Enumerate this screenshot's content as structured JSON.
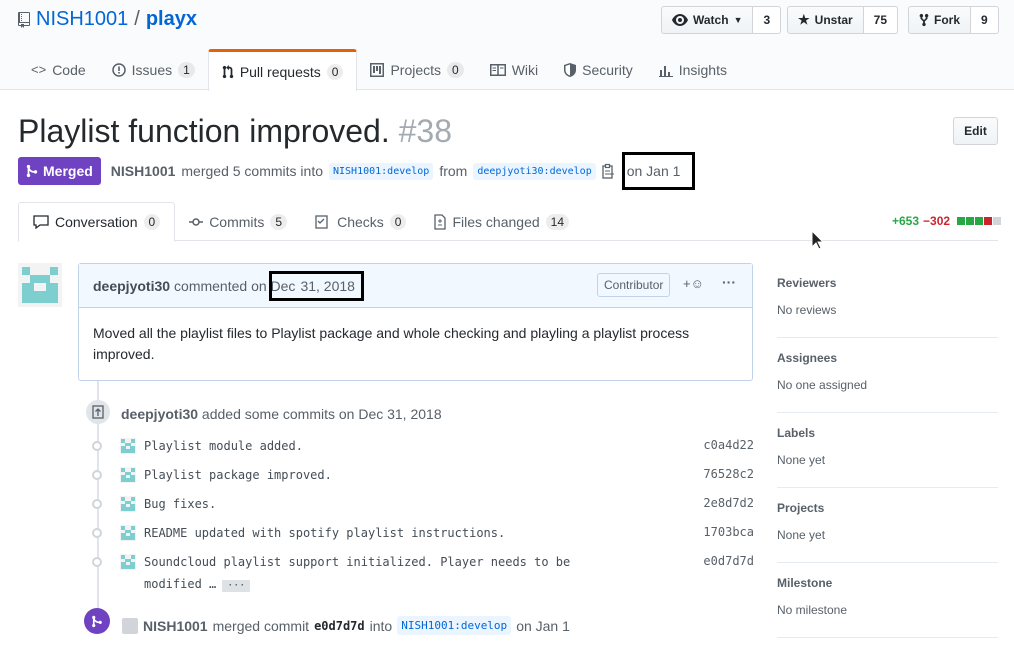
{
  "repo": {
    "owner": "NISH1001",
    "separator": "/",
    "name": "playx"
  },
  "actions": {
    "watch_label": "Watch",
    "watch_count": "3",
    "unstar_label": "Unstar",
    "star_count": "75",
    "fork_label": "Fork",
    "fork_count": "9"
  },
  "reponav": [
    {
      "label": "Code",
      "count": null
    },
    {
      "label": "Issues",
      "count": "1"
    },
    {
      "label": "Pull requests",
      "count": "0"
    },
    {
      "label": "Projects",
      "count": "0"
    },
    {
      "label": "Wiki",
      "count": null
    },
    {
      "label": "Security",
      "count": null
    },
    {
      "label": "Insights",
      "count": null
    }
  ],
  "pr": {
    "title": "Playlist function improved.",
    "number": "#38",
    "edit_label": "Edit",
    "state": "Merged",
    "merger": "NISH1001",
    "merged_text": "merged 5 commits into",
    "base_branch": "NISH1001:develop",
    "from_text": "from",
    "head_branch": "deepjyoti30:develop",
    "merged_date": "on Jan 1"
  },
  "tabs": [
    {
      "label": "Conversation",
      "count": "0"
    },
    {
      "label": "Commits",
      "count": "5"
    },
    {
      "label": "Checks",
      "count": "0"
    },
    {
      "label": "Files changed",
      "count": "14"
    }
  ],
  "diffstat": {
    "additions": "+653",
    "deletions": "−302",
    "colors": [
      "#28a745",
      "#28a745",
      "#28a745",
      "#cb2431",
      "#d1d5da"
    ]
  },
  "comment": {
    "author": "deepjyoti30",
    "commented_on": "commented on Dec",
    "date": "31, 2018",
    "badge": "Contributor",
    "body": "Moved all the playlist files to Playlist package and whole checking and playling a playlist process improved."
  },
  "commits_event": {
    "author": "deepjyoti30",
    "text": "added some commits on Dec 31, 2018"
  },
  "commits": [
    {
      "message": "Playlist module added.",
      "sha": "c0a4d22"
    },
    {
      "message": "Playlist package improved.",
      "sha": "76528c2"
    },
    {
      "message": "Bug fixes.",
      "sha": "2e8d7d2"
    },
    {
      "message": "README updated with spotify playlist instructions.",
      "sha": "1703bca"
    },
    {
      "message": "Soundcloud playlist support initialized. Player needs to be modified …",
      "sha": "e0d7d7d",
      "more": "···"
    }
  ],
  "merge_event": {
    "author": "NISH1001",
    "text": "merged commit",
    "sha": "e0d7d7d",
    "into": "into",
    "branch": "NISH1001:develop",
    "date": "on Jan 1"
  },
  "sidebar": [
    {
      "heading": "Reviewers",
      "value": "No reviews"
    },
    {
      "heading": "Assignees",
      "value": "No one assigned"
    },
    {
      "heading": "Labels",
      "value": "None yet"
    },
    {
      "heading": "Projects",
      "value": "None yet"
    },
    {
      "heading": "Milestone",
      "value": "No milestone"
    }
  ]
}
